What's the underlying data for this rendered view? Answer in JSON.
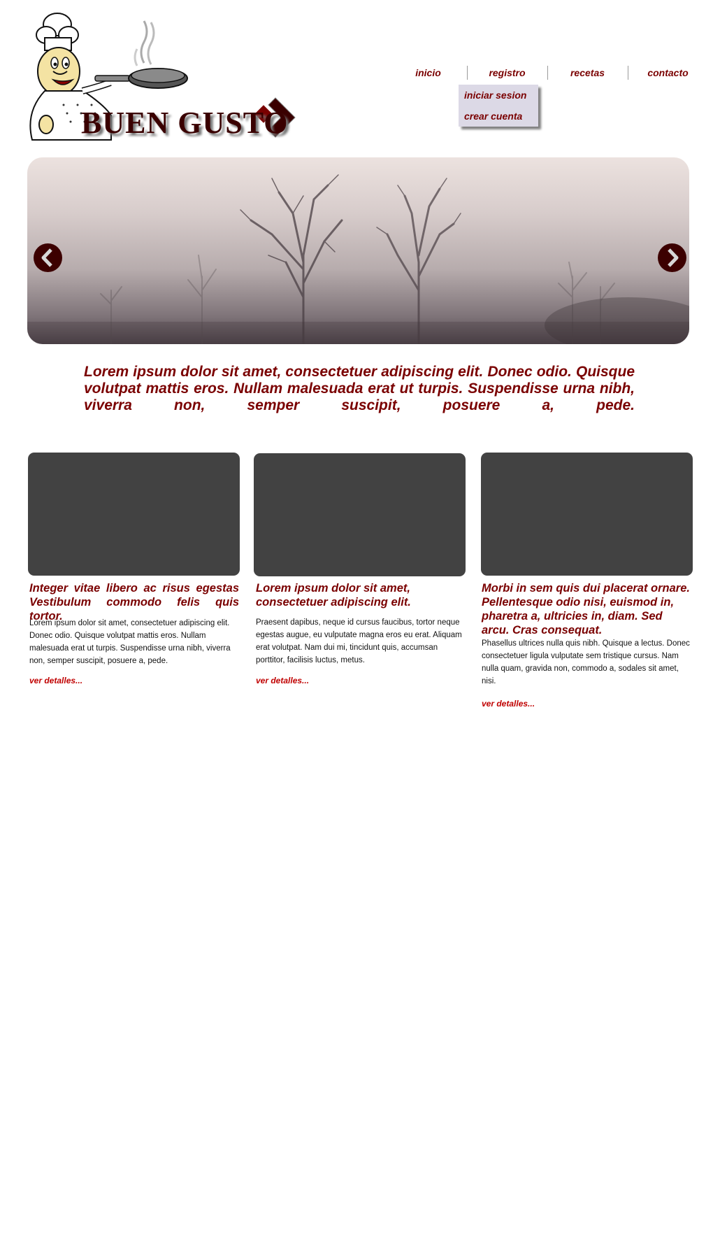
{
  "logo": {
    "brand_text": "BUEN GUSTO"
  },
  "nav": {
    "items": [
      {
        "label": "inicio"
      },
      {
        "label": "registro"
      },
      {
        "label": "recetas"
      },
      {
        "label": "contacto"
      }
    ],
    "registro_submenu": [
      {
        "label": "iniciar sesion"
      },
      {
        "label": "crear cuenta"
      }
    ]
  },
  "slider": {
    "prev_icon": "chevron-left-icon",
    "next_icon": "chevron-right-icon"
  },
  "intro": {
    "text": "Lorem ipsum dolor sit amet, consectetuer adipiscing elit. Donec odio. Quisque volutpat mattis eros. Nullam malesuada erat ut turpis. Suspendisse urna nibh, viverra non, semper suscipit, posuere a, pede."
  },
  "cards": [
    {
      "title": "Integer vitae libero ac risus egestas Vestibulum commodo felis quis tortor.",
      "body": "Lorem ipsum dolor sit amet, consectetuer adipiscing elit. Donec odio. Quisque volutpat mattis eros. Nullam malesuada erat ut turpis. Suspendisse urna nibh, viverra non, semper suscipit, posuere a, pede.",
      "link": "ver detalles..."
    },
    {
      "title": "Lorem ipsum dolor sit amet, consectetuer adipiscing elit.",
      "body": "Praesent dapibus, neque id cursus faucibus, tortor neque egestas augue, eu vulputate magna eros eu erat. Aliquam erat volutpat. Nam dui mi, tincidunt quis, accumsan porttitor, facilisis luctus, metus.",
      "link": "ver detalles..."
    },
    {
      "title": "Morbi in sem quis dui placerat ornare. Pellentesque odio nisi, euismod in, pharetra a, ultricies in, diam. Sed arcu. Cras consequat.",
      "body": "Phasellus ultrices nulla quis nibh. Quisque a lectus. Donec consectetuer ligula vulputate sem tristique cursus. Nam nulla quam, gravida non, commodo a, sodales sit amet, nisi.",
      "link": "ver detalles..."
    }
  ],
  "colors": {
    "accent": "#7a0000",
    "link": "#c00000",
    "card_placeholder": "#424242",
    "submenu_bg": "#dcd9e6",
    "arrow_bg": "#3c0000"
  }
}
